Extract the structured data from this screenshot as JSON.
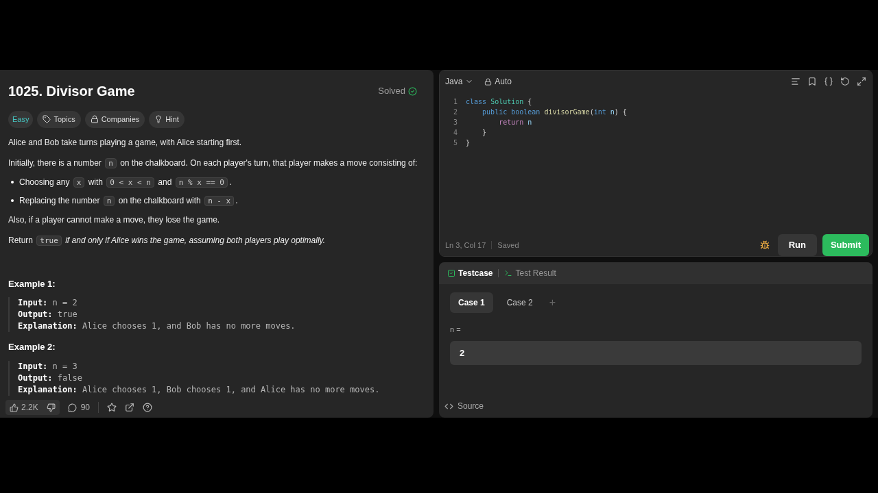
{
  "problem": {
    "title": "1025. Divisor Game",
    "status": "Solved",
    "tags": [
      {
        "kind": "difficulty",
        "label": "Easy"
      },
      {
        "kind": "topics",
        "label": "Topics"
      },
      {
        "kind": "companies",
        "label": "Companies"
      },
      {
        "kind": "hint",
        "label": "Hint"
      }
    ],
    "paragraphs": [
      {
        "kind": "para",
        "segments": [
          {
            "kind": "text",
            "text": "Alice and Bob take turns playing a game, with Alice starting first."
          }
        ]
      },
      {
        "kind": "para",
        "segments": [
          {
            "kind": "text",
            "text": "Initially, there is a number "
          },
          {
            "kind": "code",
            "text": "n"
          },
          {
            "kind": "text",
            "text": " on the chalkboard. On each player's turn, that player makes a move consisting of:"
          }
        ]
      },
      {
        "kind": "bullet",
        "segments": [
          {
            "kind": "text",
            "text": "Choosing any "
          },
          {
            "kind": "code",
            "text": "x"
          },
          {
            "kind": "text",
            "text": " with "
          },
          {
            "kind": "code",
            "text": "0 < x < n"
          },
          {
            "kind": "text",
            "text": " and "
          },
          {
            "kind": "code",
            "text": "n % x == 0"
          },
          {
            "kind": "text",
            "text": "."
          }
        ]
      },
      {
        "kind": "bullet",
        "segments": [
          {
            "kind": "text",
            "text": "Replacing the number "
          },
          {
            "kind": "code",
            "text": "n"
          },
          {
            "kind": "text",
            "text": " on the chalkboard with "
          },
          {
            "kind": "code",
            "text": "n - x"
          },
          {
            "kind": "text",
            "text": "."
          }
        ]
      },
      {
        "kind": "para",
        "segments": [
          {
            "kind": "text",
            "text": "Also, if a player cannot make a move, they lose the game."
          }
        ]
      },
      {
        "kind": "para",
        "segments": [
          {
            "kind": "text",
            "text": "Return "
          },
          {
            "kind": "code",
            "text": "true"
          },
          {
            "kind": "italic",
            "text": " if and only if Alice wins the game, assuming both players play optimally."
          }
        ]
      }
    ],
    "examples": [
      {
        "title": "Example 1:",
        "lines": [
          {
            "label": "Input:",
            "value": "n = 2"
          },
          {
            "label": "Output:",
            "value": "true"
          },
          {
            "label": "Explanation:",
            "value": "Alice chooses 1, and Bob has no more moves."
          }
        ]
      },
      {
        "title": "Example 2:",
        "lines": [
          {
            "label": "Input:",
            "value": "n = 3"
          },
          {
            "label": "Output:",
            "value": "false"
          },
          {
            "label": "Explanation:",
            "value": "Alice chooses 1, Bob chooses 1, and Alice has no more moves."
          }
        ]
      }
    ],
    "footer": {
      "likes": "2.2K",
      "comments": "90"
    }
  },
  "editor": {
    "language": "Java",
    "mode": "Auto",
    "lines": [
      {
        "number": "1",
        "tokens": [
          {
            "kind": "keyword",
            "text": "class "
          },
          {
            "kind": "type",
            "text": "Solution"
          },
          {
            "kind": "plain",
            "text": " {"
          }
        ]
      },
      {
        "number": "2",
        "tokens": [
          {
            "kind": "keyword",
            "text": "    public boolean "
          },
          {
            "kind": "method",
            "text": "divisorGame"
          },
          {
            "kind": "plain",
            "text": "("
          },
          {
            "kind": "keyword",
            "text": "int "
          },
          {
            "kind": "param",
            "text": "n"
          },
          {
            "kind": "plain",
            "text": ") {"
          }
        ]
      },
      {
        "number": "3",
        "tokens": [
          {
            "kind": "control",
            "text": "        return "
          },
          {
            "kind": "param",
            "text": "n"
          }
        ]
      },
      {
        "number": "4",
        "tokens": [
          {
            "kind": "plain",
            "text": "    }"
          }
        ]
      },
      {
        "number": "5",
        "tokens": [
          {
            "kind": "plain",
            "text": "}"
          }
        ]
      }
    ],
    "cursor": "Ln 3, Col 17",
    "save_state": "Saved",
    "buttons": [
      {
        "kind": "secondary",
        "label": "Run"
      },
      {
        "kind": "primary",
        "label": "Submit"
      }
    ]
  },
  "console": {
    "tabs": [
      {
        "label": "Testcase",
        "selected": true
      },
      {
        "label": "Test Result",
        "selected": false
      }
    ],
    "cases": [
      {
        "label": "Case 1",
        "selected": true
      },
      {
        "label": "Case 2",
        "selected": false
      }
    ],
    "add": "+",
    "param_label": "n =",
    "param_value": "2",
    "source": "Source"
  }
}
